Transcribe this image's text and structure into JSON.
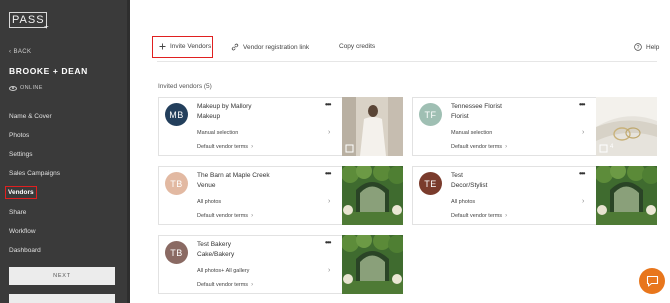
{
  "sidebar": {
    "logo": "PASS",
    "logo_mark": "+",
    "back": "BACK",
    "event_name": "BROOKE + DEAN",
    "status": "ONLINE",
    "items": [
      {
        "label": "Name & Cover"
      },
      {
        "label": "Photos"
      },
      {
        "label": "Settings"
      },
      {
        "label": "Sales Campaigns"
      },
      {
        "label": "Vendors"
      },
      {
        "label": "Share"
      },
      {
        "label": "Workflow"
      },
      {
        "label": "Dashboard"
      }
    ],
    "next_label": "NEXT"
  },
  "toolbar": {
    "invite_label": "Invite Vendors",
    "registration_label": "Vendor registration link",
    "copy_label": "Copy credits",
    "help_label": "Help"
  },
  "section_title": "Invited vendors (5)",
  "vendors": [
    {
      "initials": "MB",
      "name": "Makeup by Mallory",
      "category": "Makeup",
      "selection": "Manual selection",
      "terms": "Default vendor terms",
      "avatar_color": "#233f5c",
      "thumb": "bride",
      "count": ""
    },
    {
      "initials": "TF",
      "name": "Tennessee Florist",
      "category": "Florist",
      "selection": "Manual selection",
      "terms": "Default vendor terms",
      "avatar_color": "#9fbfb3",
      "thumb": "rings",
      "count": "4"
    },
    {
      "initials": "TB",
      "name": "The Barn at Maple Creek",
      "category": "Venue",
      "selection": "All photos",
      "terms": "Default vendor terms",
      "avatar_color": "#e2b9a2",
      "thumb": "garden",
      "count": ""
    },
    {
      "initials": "TE",
      "name": "Test",
      "category": "Decor/Stylist",
      "selection": "All photos",
      "terms": "Default vendor terms",
      "avatar_color": "#7a3b2c",
      "thumb": "garden",
      "count": ""
    },
    {
      "initials": "TB",
      "name": "Test Bakery",
      "category": "Cake/Bakery",
      "selection": "All photos+ All gallery",
      "terms": "Default vendor terms",
      "avatar_color": "#8a6a63",
      "thumb": "garden",
      "count": ""
    }
  ],
  "colors": {
    "sidebar_bg": "#3a3a3a",
    "highlight": "#e02020",
    "chat_button": "#e8761c"
  },
  "icons": {
    "invite": "plus-icon",
    "registration": "link-icon",
    "help": "help-circle-icon",
    "menu": "more-dots-icon",
    "chat": "chat-icon"
  }
}
